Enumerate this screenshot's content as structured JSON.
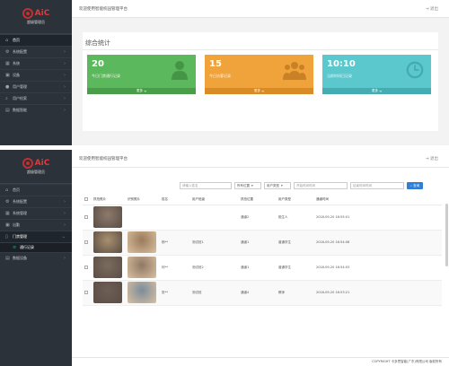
{
  "brand": {
    "logo_text": "AiC",
    "subtitle": "超級管理员"
  },
  "top": {
    "welcome": "欢迎使用智能校园管理平台",
    "exit": "退出",
    "sidebar": [
      {
        "label": "首页",
        "icon": "home-icon",
        "active": true
      },
      {
        "label": "系统配置",
        "icon": "gear-icon"
      },
      {
        "label": "系统",
        "icon": "grid-icon"
      },
      {
        "label": "设备",
        "icon": "device-icon"
      },
      {
        "label": "用户管理",
        "icon": "user-icon"
      },
      {
        "label": "用户检索",
        "icon": "search-icon"
      },
      {
        "label": "数据智能",
        "icon": "chart-icon"
      }
    ],
    "section_title": "综合统计",
    "stats": [
      {
        "value": "20",
        "label": "今日门禁通行记录",
        "footer": "更多",
        "color": "#5cb85c"
      },
      {
        "value": "15",
        "label": "今日访客记录",
        "footer": "更多",
        "color": "#f0a33a"
      },
      {
        "value": "10:10",
        "label": "当前时间日记录",
        "footer": "更多",
        "color": "#5bc8cd"
      }
    ]
  },
  "bottom": {
    "welcome": "欢迎使用智能校园管理平台",
    "exit": "退出",
    "sidebar": [
      {
        "label": "首页",
        "icon": "home-icon"
      },
      {
        "label": "系统配置",
        "icon": "gear-icon"
      },
      {
        "label": "系统管理",
        "icon": "grid-icon"
      },
      {
        "label": "出勤",
        "icon": "device-icon"
      },
      {
        "label": "门禁管理",
        "icon": "door-icon",
        "active": true
      },
      {
        "label": "通行记录",
        "icon": "list-icon",
        "sub": true
      },
      {
        "label": "数据设备",
        "icon": "chart-icon"
      }
    ],
    "filters": {
      "name_placeholder": "请输入姓名",
      "location_select": "所有位置",
      "type_select": "用户类型",
      "start_placeholder": "开始时间时间",
      "end_placeholder": "结束时间时间",
      "search_button": "查询"
    },
    "columns": [
      "",
      "抓拍照片",
      "识别照片",
      "姓名",
      "用户班级",
      "抓拍位置",
      "用户类型",
      "通道时间"
    ],
    "rows": [
      {
        "name": "",
        "class": "",
        "location": "通道2",
        "type": "陌生人",
        "time": "2018-09-20  16:55:01",
        "photo1": "#8d7a6c",
        "photo2": ""
      },
      {
        "name": "杨**",
        "class": "测试班1",
        "location": "通道1",
        "type": "普通学生",
        "time": "2018-09-20  16:54:08",
        "photo1": "#a8906f",
        "photo2": "#9a7a5a"
      },
      {
        "name": "何**",
        "class": "测试班2",
        "location": "通道1",
        "type": "普通学生",
        "time": "2018-09-20  16:54:03",
        "photo1": "#7c6c5e",
        "photo2": "#8f7865"
      },
      {
        "name": "张**",
        "class": "测试班",
        "location": "通道4",
        "type": "教师",
        "time": "2018-09-20  16:53:21",
        "photo1": "#6e5e55",
        "photo2": "#7a8c9c"
      }
    ],
    "footer": "COPYRIGHT 卡多思智能(广东)有限公司 版权所有"
  }
}
